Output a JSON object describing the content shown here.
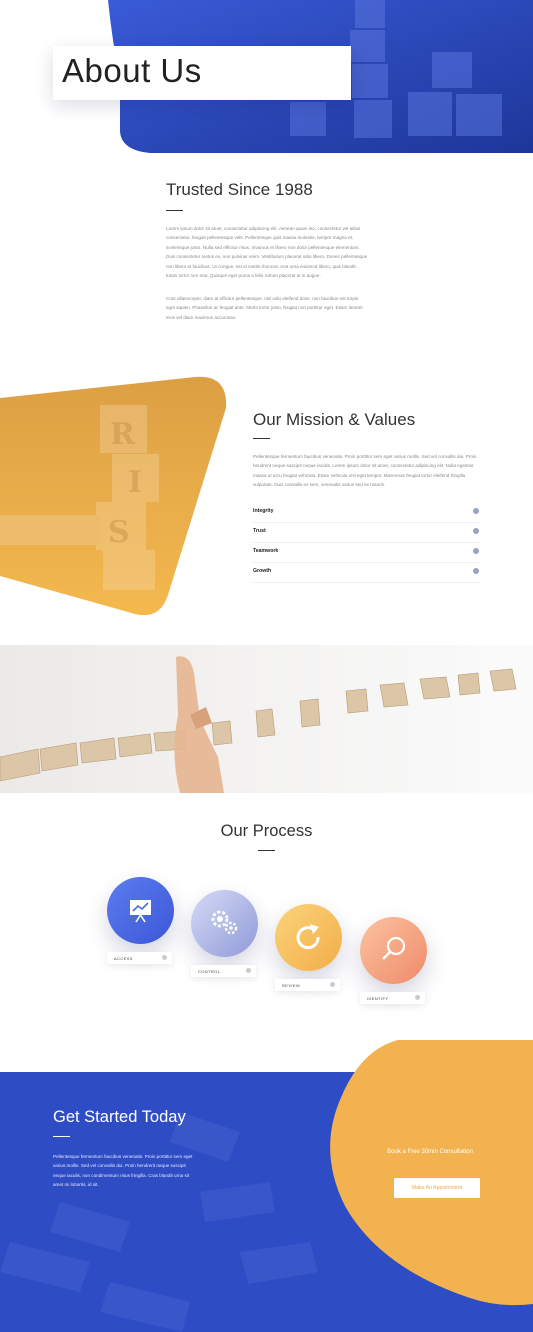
{
  "hero": {
    "title": "About Us"
  },
  "trusted": {
    "title": "Trusted Since 1988",
    "p1": "Lorem ipsum dolor sit amet, consectetur adipiscing elit. Aenean quam leo, consectetur vel tellus consectetur, feugiat pellentesque velit. Pellentesque quis massa molestie, tempor magna et, scelerisque justo. Nulla sed efficitur risus. Vivamus et libero non dolor pellentesque elementum. Duis consectetur metus ex, non pulvinar enim. Vestibulum placerat odio libero. Donec pellentesque non libero et faucibus. Ut congue, est id mattis rhoncus, erat urna euismod libero, quis blandit turpis tortor non erat. Quisque eget purus a felis rutrum placerat ut in augue.",
    "p2": "Cras ullamcorper, diam at efficitur pellentesque, nisl odio eleifend dolor, non faucibus est turpis eget sapien. Phasellus ac feugiat ante. Morbi tortor justo, feugiat non porttitor eget. Etiam laoreet eros vel diam maximus accumsan."
  },
  "mission": {
    "title": "Our Mission & Values",
    "paragraph": "Pellentesque fermentum faucibus venenatis. Proin porttitor sem eget varius mollis. Sed vel convallis dui. Proin hendrerit neque suscipit neque iaculis. Lorem ipsum dolor sit amet, consectetur adipiscing elit. Nulla egestas massa ut arcu feugiat vehicula. Etiam vehicula nisl eget tempor. Maecenas feugiat tortor eleifend fringilla vulputate. Duis convallis ex sem, venenatis varius sed ex mauris.",
    "items": [
      {
        "label": "Integrity"
      },
      {
        "label": "Trust"
      },
      {
        "label": "Teamwork"
      },
      {
        "label": "Growth"
      }
    ]
  },
  "process": {
    "title": "Our Process",
    "steps": [
      {
        "label": "ACCESS",
        "icon": "presentation-icon",
        "color_from": "#5b7cf0",
        "color_to": "#3d57d6"
      },
      {
        "label": "CONTROL",
        "icon": "gears-icon",
        "color_from": "#c9cff3",
        "color_to": "#8f9ad8"
      },
      {
        "label": "REVIEW",
        "icon": "refresh-icon",
        "color_from": "#fbd47c",
        "color_to": "#f2ad48"
      },
      {
        "label": "IDENTIFY",
        "icon": "search-icon",
        "color_from": "#fbbf9a",
        "color_to": "#f0896a"
      }
    ]
  },
  "get_started": {
    "title": "Get Started Today",
    "paragraph": "Pellentesque fermentum faucibus venenatis. Proin porttitor sem eget varius mollis. Sed vel convallis dui. Proin hendrerit neque suscipit neque iaculis, non condimentum risus fringilla. Cras blandit urna sit amet mi lobortis, id sit.",
    "book_text": "Book a Free 30min Consultation",
    "button": "Make An Appointment"
  },
  "colors": {
    "primary_blue": "#2e4cc4",
    "accent_orange": "#f2b24f"
  }
}
